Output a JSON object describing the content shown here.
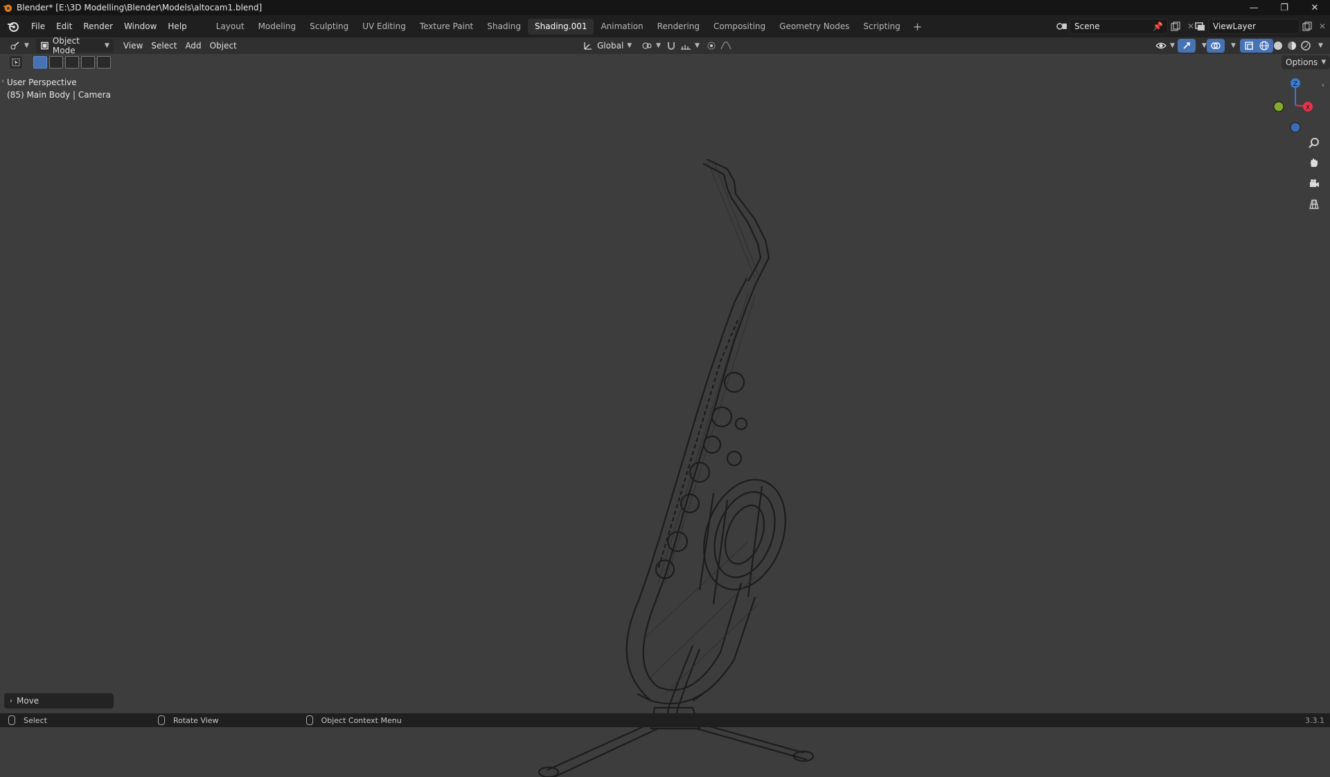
{
  "window": {
    "title": "Blender* [E:\\3D Modelling\\Blender\\Models\\altocam1.blend]",
    "minimize_glyph": "—",
    "restore_glyph": "❐",
    "close_glyph": "✕"
  },
  "menu": [
    "File",
    "Edit",
    "Render",
    "Window",
    "Help"
  ],
  "workspaces": [
    "Layout",
    "Modeling",
    "Sculpting",
    "UV Editing",
    "Texture Paint",
    "Shading",
    "Shading.001",
    "Animation",
    "Rendering",
    "Compositing",
    "Geometry Nodes",
    "Scripting"
  ],
  "active_workspace": "Shading.001",
  "add_workspace_glyph": "+",
  "scene": {
    "name": "Scene"
  },
  "view_layer": {
    "name": "ViewLayer"
  },
  "viewport_header": {
    "mode": "Object Mode",
    "menus": [
      "View",
      "Select",
      "Add",
      "Object"
    ],
    "transform_orientation": "Global",
    "options_label": "Options"
  },
  "viewport": {
    "perspective_label": "User Perspective",
    "object_info": "(85) Main Body | Camera",
    "gizmo_axes": {
      "z": "Z",
      "x": "X"
    },
    "last_operator": "Move"
  },
  "statusbar": {
    "items": [
      "Select",
      "Rotate View",
      "Object Context Menu"
    ],
    "version": "3.3.1"
  },
  "colors": {
    "viewport_bg": "#3d3d3d",
    "accent_blue": "#4772b3",
    "axis_x": "#e8334d",
    "axis_y": "#86a92f",
    "axis_z": "#3a7ad1"
  },
  "icons": [
    "blender-logo-icon",
    "editor-type-icon",
    "object-mode-icon",
    "select-box-icon",
    "zoom-icon",
    "pan-hand-icon",
    "camera-view-icon",
    "grid-ortho-icon"
  ]
}
